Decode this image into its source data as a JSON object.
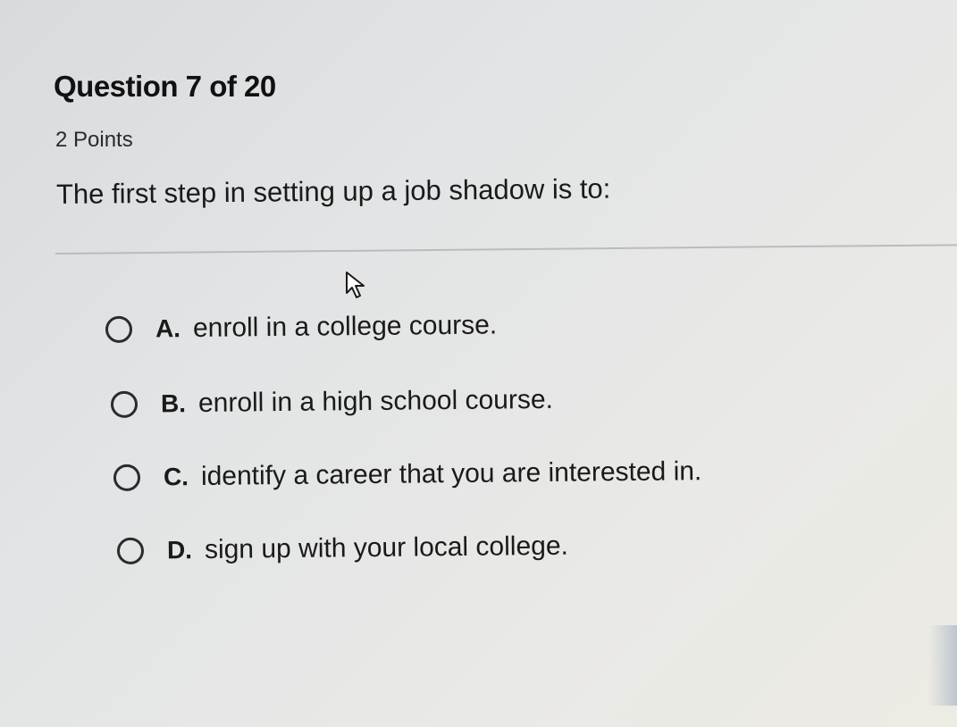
{
  "question": {
    "title": "Question 7 of 20",
    "points": "2 Points",
    "prompt": "The first step in setting up a job shadow is to:"
  },
  "options": [
    {
      "letter": "A.",
      "text": "enroll in a college course.",
      "selected": false
    },
    {
      "letter": "B.",
      "text": "enroll in a high school course.",
      "selected": false
    },
    {
      "letter": "C.",
      "text": "identify a career that you are interested in.",
      "selected": false
    },
    {
      "letter": "D.",
      "text": "sign up with your local college.",
      "selected": false
    }
  ],
  "icons": {
    "cursor": "mouse-pointer-icon",
    "radio": "radio-button-icon"
  },
  "colors": {
    "background": "#e3e5e5",
    "text": "#1a1a1a",
    "divider": "#b9bcbe"
  }
}
